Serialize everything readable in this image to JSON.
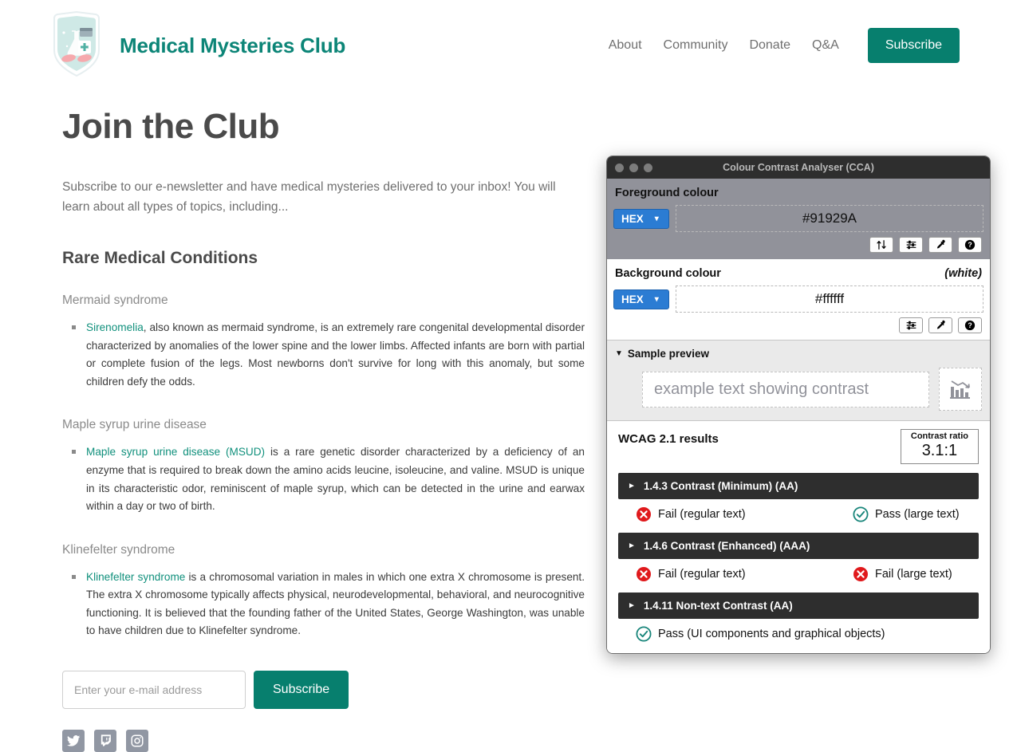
{
  "header": {
    "brand_title": "Medical Mysteries Club",
    "logo_icon": "shield-medical-badge-icon",
    "nav": [
      {
        "label": "About"
      },
      {
        "label": "Community"
      },
      {
        "label": "Donate"
      },
      {
        "label": "Q&A"
      }
    ],
    "subscribe_label": "Subscribe"
  },
  "main": {
    "page_title": "Join the Club",
    "intro": "Subscribe to our e-newsletter and have medical mysteries delivered to your inbox! You will learn about all types of topics, including...",
    "section_title": "Rare Medical Conditions",
    "conditions": [
      {
        "heading": "Mermaid syndrome",
        "link_text": "Sirenomelia",
        "body": ", also known as mermaid syndrome, is an extremely rare congenital developmental disorder characterized by anomalies of the lower spine and the lower limbs. Affected infants are born with partial or complete fusion of the legs. Most newborns don't survive for long with this anomaly, but some children defy the odds."
      },
      {
        "heading": "Maple syrup urine disease",
        "link_text": "Maple syrup urine disease (MSUD)",
        "body": " is a rare genetic disorder characterized by a deficiency of an enzyme that is required to break down the amino acids leucine, isoleucine, and valine. MSUD is unique in its characteristic odor, reminiscent of maple syrup, which can be detected in the urine and earwax within a day or two of birth."
      },
      {
        "heading": "Klinefelter syndrome",
        "link_text": "Klinefelter syndrome",
        "body": " is a chromosomal variation in males in which one extra X chromosome is present. The extra X chromosome typically affects physical, neurodevelopmental, behavioral, and neurocognitive functioning. It is believed that the founding father of the United States, George Washington, was unable to have children due to Klinefelter syndrome."
      }
    ],
    "form": {
      "email_placeholder": "Enter your e-mail address",
      "email_value": "",
      "submit_label": "Subscribe"
    },
    "social": [
      {
        "name": "twitter-icon"
      },
      {
        "name": "twitch-icon"
      },
      {
        "name": "instagram-icon"
      }
    ]
  },
  "cca": {
    "window_title": "Colour Contrast Analyser (CCA)",
    "foreground": {
      "label": "Foreground colour",
      "format": "HEX",
      "value": "#91929A",
      "tools": [
        "swap-colours-icon",
        "colour-sliders-icon",
        "eyedropper-icon",
        "help-icon"
      ]
    },
    "background": {
      "label": "Background colour",
      "note": "(white)",
      "format": "HEX",
      "value": "#ffffff",
      "tools": [
        "colour-sliders-icon",
        "eyedropper-icon",
        "help-icon"
      ]
    },
    "preview": {
      "disclosure_label": "Sample preview",
      "sample_text": "example text showing contrast",
      "graphic_icon": "bar-chart-declining-icon"
    },
    "results": {
      "title": "WCAG 2.1 results",
      "ratio_label": "Contrast ratio",
      "ratio_value": "3.1:1",
      "criteria": [
        {
          "label": "1.4.3 Contrast (Minimum) (AA)",
          "outcomes": [
            {
              "status": "fail",
              "text": "Fail (regular text)"
            },
            {
              "status": "pass",
              "text": "Pass (large text)"
            }
          ]
        },
        {
          "label": "1.4.6 Contrast (Enhanced) (AAA)",
          "outcomes": [
            {
              "status": "fail",
              "text": "Fail (regular text)"
            },
            {
              "status": "fail",
              "text": "Fail (large text)"
            }
          ]
        },
        {
          "label": "1.4.11 Non-text Contrast (AA)",
          "outcomes": [
            {
              "status": "pass",
              "text": "Pass (UI components and graphical objects)"
            }
          ]
        }
      ]
    }
  },
  "colors": {
    "brand_teal": "#0c8577",
    "button_green": "#077f6e",
    "link_teal": "#10907c",
    "fail_red": "#e0191c",
    "pass_teal": "#18857a",
    "select_blue": "#2b7cd3",
    "fg_colour_swatch": "#91929A",
    "titlebar_dark": "#2e2e2e"
  }
}
